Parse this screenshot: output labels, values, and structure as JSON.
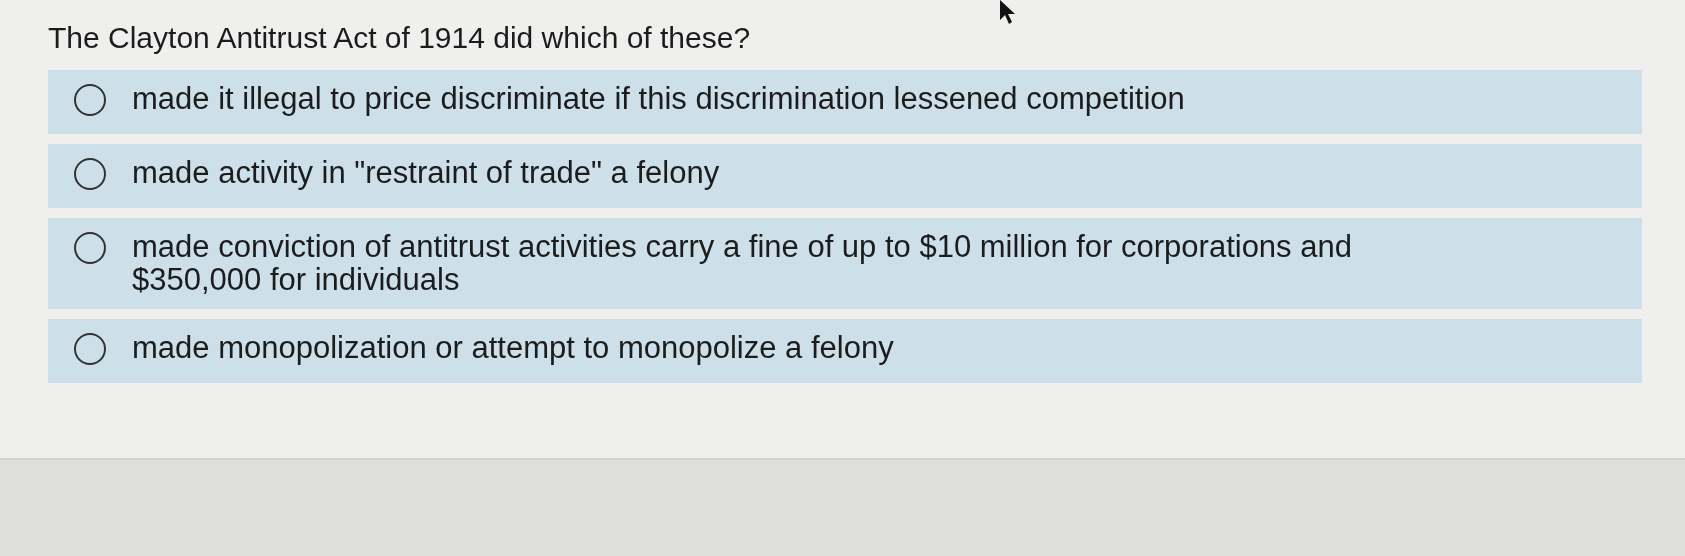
{
  "question": "The Clayton Antitrust Act of 1914 did which of these?",
  "options": [
    {
      "label": "made it illegal to price discriminate if this discrimination lessened competition",
      "selected": false
    },
    {
      "label": "made activity in \"restraint of trade\" a felony",
      "selected": false
    },
    {
      "label": "made conviction of antitrust activities carry a fine of up to $10 million for corporations and $350,000 for individuals",
      "selected": false
    },
    {
      "label": "made monopolization or attempt to monopolize a felony",
      "selected": false
    }
  ]
}
